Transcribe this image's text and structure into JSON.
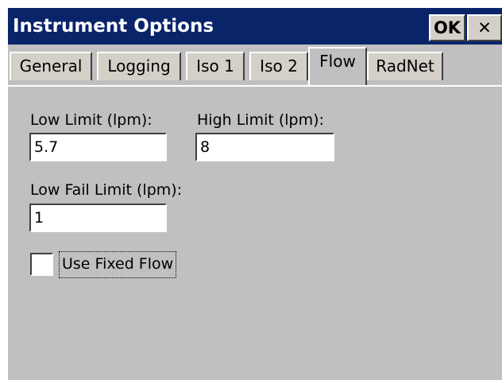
{
  "window": {
    "title": "Instrument Options",
    "ok_label": "OK",
    "close_label": "✕"
  },
  "tabs": [
    {
      "label": "General"
    },
    {
      "label": "Logging"
    },
    {
      "label": "Iso 1"
    },
    {
      "label": "Iso 2"
    },
    {
      "label": "Flow",
      "active": true
    },
    {
      "label": "RadNet"
    }
  ],
  "flow": {
    "low_limit_label": "Low Limit (lpm):",
    "low_limit_value": "5.7",
    "high_limit_label": "High Limit (lpm):",
    "high_limit_value": "8",
    "low_fail_label": "Low Fail Limit (lpm):",
    "low_fail_value": "1",
    "use_fixed_flow_label": "Use Fixed Flow",
    "use_fixed_flow_checked": false
  },
  "colors": {
    "titlebar": "#0a246a",
    "panel": "#c0c0c0",
    "button_face": "#d4d0c8"
  }
}
